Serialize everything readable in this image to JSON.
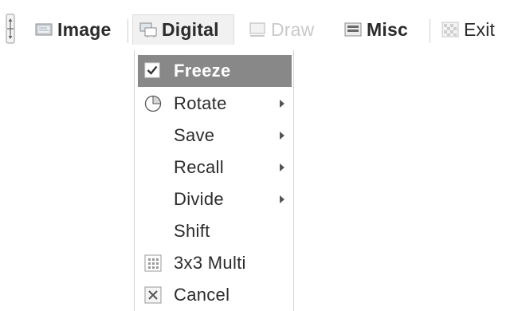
{
  "menubar": {
    "items": [
      {
        "label": "Image",
        "icon": "image-icon",
        "state": "normal"
      },
      {
        "label": "Digital",
        "icon": "digital-icon",
        "state": "active"
      },
      {
        "label": "Draw",
        "icon": "draw-icon",
        "state": "disabled"
      },
      {
        "label": "Misc",
        "icon": "misc-icon",
        "state": "normal"
      },
      {
        "label": "Exit",
        "icon": "exit-icon",
        "state": "normal"
      }
    ]
  },
  "dropdown": {
    "items": [
      {
        "label": "Freeze",
        "icon": "checkbox-checked-icon",
        "submenu": false,
        "selected": true
      },
      {
        "label": "Rotate",
        "icon": "rotate-icon",
        "submenu": true,
        "selected": false
      },
      {
        "label": "Save",
        "icon": "",
        "submenu": true,
        "selected": false
      },
      {
        "label": "Recall",
        "icon": "",
        "submenu": true,
        "selected": false
      },
      {
        "label": "Divide",
        "icon": "",
        "submenu": true,
        "selected": false
      },
      {
        "label": "Shift",
        "icon": "",
        "submenu": false,
        "selected": false
      },
      {
        "label": "3x3 Multi",
        "icon": "grid-icon",
        "submenu": false,
        "selected": false
      },
      {
        "label": "Cancel",
        "icon": "cancel-icon",
        "submenu": false,
        "selected": false
      }
    ]
  },
  "colors": {
    "selected_bg": "#888888",
    "disabled_text": "#c9c9c9",
    "text": "#2b2b2b"
  }
}
